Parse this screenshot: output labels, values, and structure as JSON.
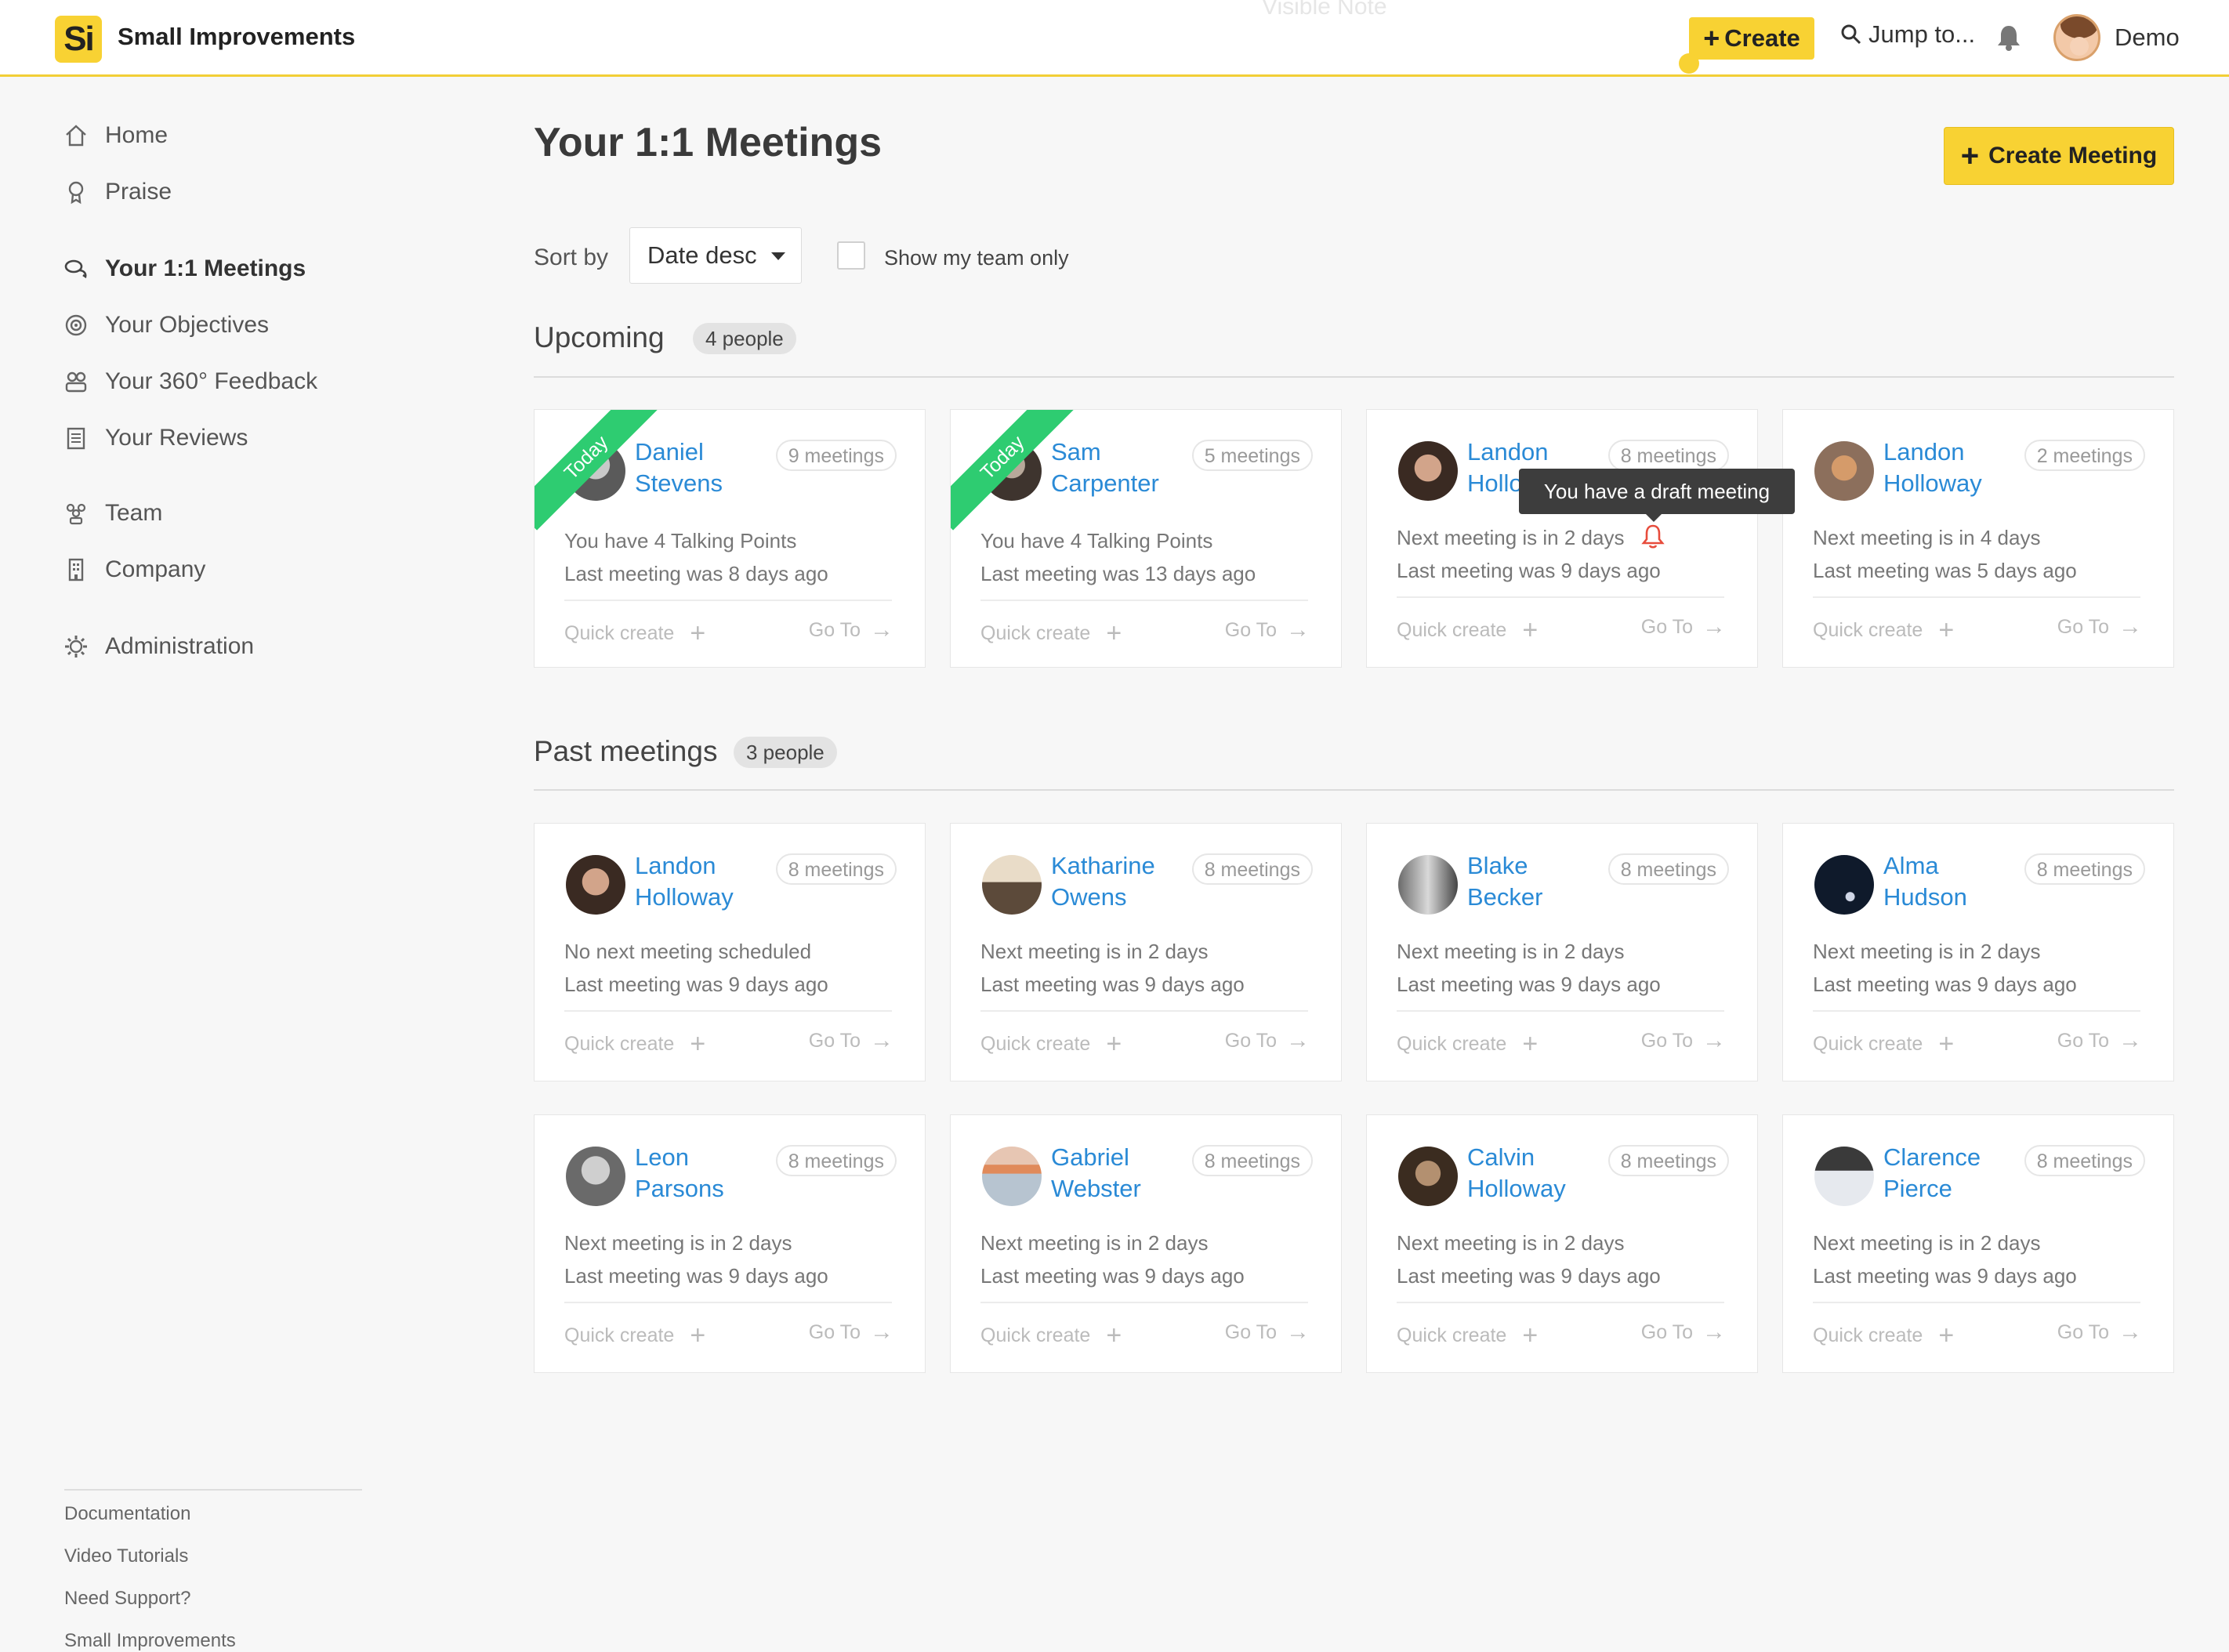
{
  "header": {
    "logo_text": "Si",
    "app_name": "Small Improvements",
    "ghost_text": "Visible Note",
    "create_label": "Create",
    "jump_label": "Jump to...",
    "user_name": "Demo"
  },
  "sidebar": {
    "items": [
      {
        "label": "Home",
        "icon": "home-icon"
      },
      {
        "label": "Praise",
        "icon": "praise-icon"
      },
      {
        "label": "Your 1:1 Meetings",
        "icon": "chat-icon",
        "active": true
      },
      {
        "label": "Your Objectives",
        "icon": "target-icon"
      },
      {
        "label": "Your 360° Feedback",
        "icon": "people-icon"
      },
      {
        "label": "Your Reviews",
        "icon": "document-icon"
      },
      {
        "label": "Team",
        "icon": "team-icon"
      },
      {
        "label": "Company",
        "icon": "building-icon"
      },
      {
        "label": "Administration",
        "icon": "gear-icon"
      }
    ],
    "footer": [
      "Documentation",
      "Video Tutorials",
      "Need Support?",
      "Small Improvements"
    ]
  },
  "main": {
    "title": "Your 1:1 Meetings",
    "create_meeting_label": "Create Meeting",
    "sort_label": "Sort by",
    "sort_value": "Date desc",
    "team_only_label": "Show my team only",
    "tooltip": "You have a draft meeting",
    "upcoming": {
      "title": "Upcoming",
      "badge": "4 people",
      "cards": [
        {
          "first": "Daniel",
          "last": "Stevens",
          "meetings": "9 meetings",
          "line1": "You have 4 Talking Points",
          "line2": "Last meeting was 8 days ago",
          "ribbon": "Today",
          "quick": "Quick create",
          "goto": "Go To"
        },
        {
          "first": "Sam",
          "last": "Carpenter",
          "meetings": "5 meetings",
          "line1": "You have 4 Talking Points",
          "line2": "Last meeting was 13 days ago",
          "ribbon": "Today",
          "quick": "Quick create",
          "goto": "Go To"
        },
        {
          "first": "Landon",
          "last": "Holloway",
          "meetings": "8 meetings",
          "line1": "Next meeting is in 2 days",
          "line2": "Last meeting was 9 days ago",
          "ribbon": "",
          "quick": "Quick create",
          "goto": "Go To"
        },
        {
          "first": "Landon",
          "last": "Holloway",
          "meetings": "2 meetings",
          "line1": "Next meeting is in 4 days",
          "line2": "Last meeting was 5 days ago",
          "ribbon": "",
          "quick": "Quick create",
          "goto": "Go To"
        }
      ]
    },
    "past": {
      "title": "Past meetings",
      "badge": "3 people",
      "cards": [
        {
          "first": "Landon",
          "last": "Holloway",
          "meetings": "8 meetings",
          "line1": "No next meeting scheduled",
          "line2": "Last meeting was 9 days ago",
          "quick": "Quick create",
          "goto": "Go To"
        },
        {
          "first": "Katharine",
          "last": "Owens",
          "meetings": "8 meetings",
          "line1": "Next meeting is in 2 days",
          "line2": "Last meeting was 9 days ago",
          "quick": "Quick create",
          "goto": "Go To"
        },
        {
          "first": "Blake",
          "last": "Becker",
          "meetings": "8 meetings",
          "line1": "Next meeting is in 2 days",
          "line2": "Last meeting was 9 days ago",
          "quick": "Quick create",
          "goto": "Go To"
        },
        {
          "first": "Alma",
          "last": "Hudson",
          "meetings": "8 meetings",
          "line1": "Next meeting is in 2 days",
          "line2": "Last meeting was 9 days ago",
          "quick": "Quick create",
          "goto": "Go To"
        },
        {
          "first": "Leon",
          "last": "Parsons",
          "meetings": "8 meetings",
          "line1": "Next meeting is in 2 days",
          "line2": "Last meeting was 9 days ago",
          "quick": "Quick create",
          "goto": "Go To"
        },
        {
          "first": "Gabriel",
          "last": "Webster",
          "meetings": "8 meetings",
          "line1": "Next meeting is in 2 days",
          "line2": "Last meeting was 9 days ago",
          "quick": "Quick create",
          "goto": "Go To"
        },
        {
          "first": "Calvin",
          "last": "Holloway",
          "meetings": "8 meetings",
          "line1": "Next meeting is in 2 days",
          "line2": "Last meeting was 9 days ago",
          "quick": "Quick create",
          "goto": "Go To"
        },
        {
          "first": "Clarence",
          "last": "Pierce",
          "meetings": "8 meetings",
          "line1": "Next meeting is in 2 days",
          "line2": "Last meeting was 9 days ago",
          "quick": "Quick create",
          "goto": "Go To"
        }
      ]
    }
  },
  "colors": {
    "accent_yellow": "#f8d233",
    "link_blue": "#2a8ad6",
    "ribbon_green": "#2ecc71",
    "alert_red": "#e74c3c"
  }
}
